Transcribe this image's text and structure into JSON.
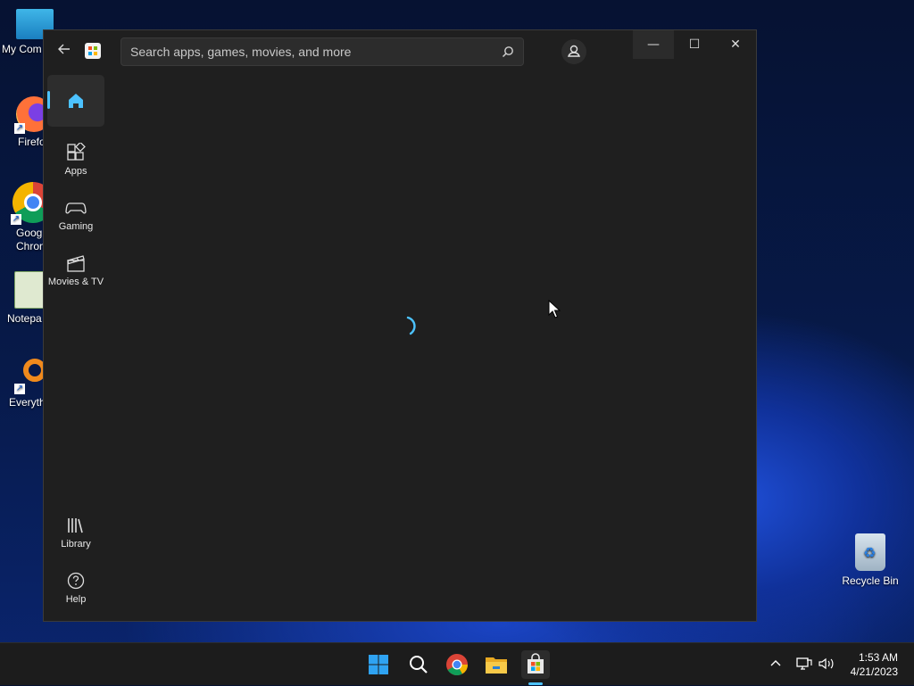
{
  "desktop": {
    "icons": [
      {
        "label": "My Com",
        "icon": "monitor-icon"
      },
      {
        "label": "Firefo",
        "icon": "firefox-icon"
      },
      {
        "label": "Goog\nChron",
        "icon": "chrome-icon"
      },
      {
        "label": "Notepa",
        "icon": "notepad-icon"
      },
      {
        "label": "Everyth",
        "icon": "everything-search-icon"
      }
    ],
    "recycle_bin_label": "Recycle Bin"
  },
  "store": {
    "search_placeholder": "Search apps, games, movies, and more",
    "nav": {
      "home": "",
      "apps": "Apps",
      "gaming": "Gaming",
      "movies": "Movies & TV",
      "library": "Library",
      "help": "Help"
    },
    "window_buttons": {
      "minimize": "—",
      "maximize": "☐",
      "close": "✕"
    },
    "accent_color": "#4cc2ff"
  },
  "taskbar": {
    "icons": [
      "start-icon",
      "search-icon",
      "chrome-icon",
      "file-explorer-icon",
      "microsoft-store-icon"
    ],
    "tray": {
      "chevron": "^"
    },
    "time": "1:53 AM",
    "date": "4/21/2023"
  }
}
